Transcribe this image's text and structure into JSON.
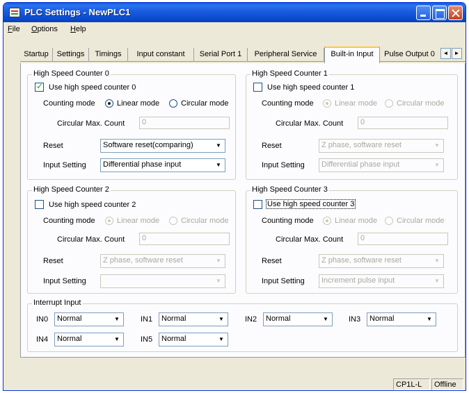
{
  "window": {
    "title": "PLC Settings - NewPLC1"
  },
  "menu": [
    "File",
    "Options",
    "Help"
  ],
  "tabs": [
    "Startup",
    "Settings",
    "Timings",
    "Input constant",
    "Serial Port 1",
    "Peripheral Service",
    "Built-in Input",
    "Pulse Output 0"
  ],
  "tab_nav": {
    "prev": "◄",
    "next": "►"
  },
  "labels": {
    "counting_mode": "Counting mode",
    "linear_mode": "Linear mode",
    "circular_mode": "Circular mode",
    "circular_max_count": "Circular Max. Count",
    "reset": "Reset",
    "input_setting": "Input Setting"
  },
  "hsc": [
    {
      "title": "High Speed Counter 0",
      "checkbox_label": "Use high speed counter 0",
      "enabled": true,
      "mode": "linear",
      "max_count": "0",
      "reset": "Software reset(comparing)",
      "input": "Differential phase input"
    },
    {
      "title": "High Speed Counter 1",
      "checkbox_label": "Use high speed counter 1",
      "enabled": false,
      "mode": "linear",
      "max_count": "0",
      "reset": "Z phase, software reset",
      "input": "Differential phase input"
    },
    {
      "title": "High Speed Counter 2",
      "checkbox_label": "Use high speed counter 2",
      "enabled": false,
      "mode": "linear",
      "max_count": "0",
      "reset": "Z phase, software reset",
      "input": ""
    },
    {
      "title": "High Speed Counter 3",
      "checkbox_label": "Use high speed counter 3",
      "enabled": false,
      "mode": "linear",
      "max_count": "0",
      "reset": "Z phase, software reset",
      "input": "Increment pulse input"
    }
  ],
  "interrupt": {
    "title": "Interrupt Input",
    "items": [
      {
        "label": "IN0",
        "value": "Normal"
      },
      {
        "label": "IN1",
        "value": "Normal"
      },
      {
        "label": "IN2",
        "value": "Normal"
      },
      {
        "label": "IN3",
        "value": "Normal"
      },
      {
        "label": "IN4",
        "value": "Normal"
      },
      {
        "label": "IN5",
        "value": "Normal"
      }
    ]
  },
  "status": {
    "model": "CP1L-L",
    "connection": "Offline"
  },
  "icons": {
    "dropdown": "▼"
  }
}
